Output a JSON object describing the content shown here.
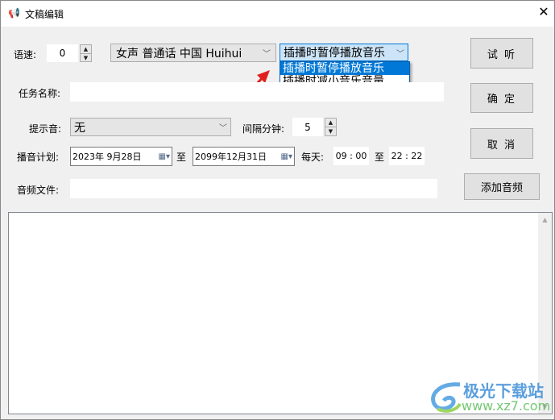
{
  "window": {
    "title": "文稿编辑",
    "close": "✕"
  },
  "speed": {
    "label": "语速:",
    "value": "0"
  },
  "voice": {
    "value": "女声 普通话 中国 Huihui"
  },
  "mode": {
    "value": "插播时暂停播放音乐",
    "options": [
      "插播时暂停播放音乐",
      "插播时减小音乐音量"
    ]
  },
  "task": {
    "label": "任务名称:",
    "value": ""
  },
  "prompt": {
    "label": "提示音:",
    "value": "无"
  },
  "interval": {
    "label": "间隔分钟:",
    "value": "5"
  },
  "schedule": {
    "label": "播音计划:",
    "start": "2023年  9月28日",
    "to": "至",
    "end": "2099年12月31日",
    "daily_label": "每天:",
    "time_start": "09 : 00",
    "time_to": "至",
    "time_end": "22 : 22"
  },
  "audio": {
    "label": "音频文件:",
    "value": ""
  },
  "buttons": {
    "preview": "试 听",
    "ok": "确 定",
    "cancel": "取 消",
    "add_audio": "添加音频"
  },
  "content": {
    "text": ""
  },
  "watermark": {
    "name": "极光下载站",
    "url": "www.xz7.com"
  },
  "colors": {
    "accent": "#0078d7",
    "arrow": "#e02020"
  }
}
